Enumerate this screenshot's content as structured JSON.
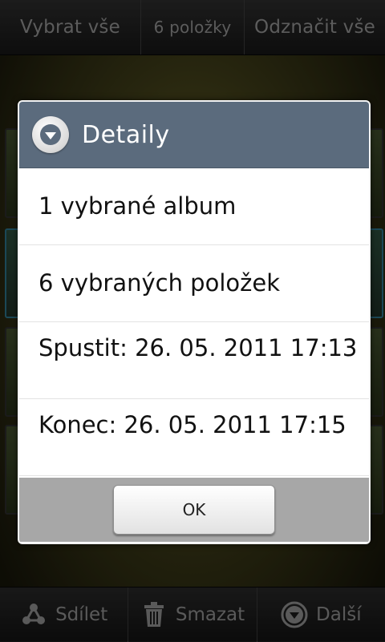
{
  "topbar": {
    "select_all": "Vybrat vše",
    "item_count": "6 položky",
    "deselect_all": "Odznačit vše"
  },
  "bottombar": {
    "share": "Sdílet",
    "delete": "Smazat",
    "more": "Další"
  },
  "dialog": {
    "title": "Detaily",
    "rows": [
      "1 vybrané album",
      "6 vybraných položek",
      "Spustit: 26. 05. 2011 17:13",
      "Konec: 26. 05. 2011 17:15"
    ],
    "ok_label": "OK"
  },
  "colors": {
    "header": "#5b6b7d",
    "footer": "#a7a7a7"
  }
}
